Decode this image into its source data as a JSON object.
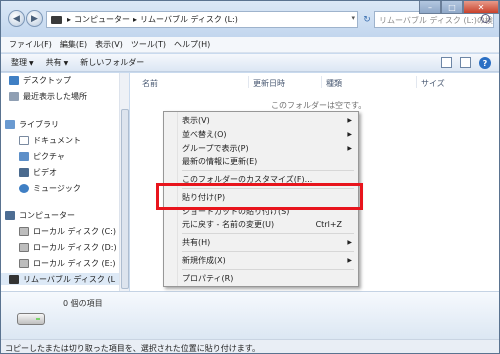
{
  "address": {
    "crumbs": [
      "コンピューター",
      "リムーバブル ディスク (L:)"
    ],
    "separator": "▸"
  },
  "search": {
    "placeholder": "リムーバブル ディスク (L:)の検索"
  },
  "window_controls": {
    "minimize": "–",
    "maximize": "□",
    "close": "✕"
  },
  "menubar": [
    "ファイル(F)",
    "編集(E)",
    "表示(V)",
    "ツール(T)",
    "ヘルプ(H)"
  ],
  "toolbar": {
    "organize": "整理",
    "share": "共有",
    "new_folder": "新しいフォルダー"
  },
  "navpane": {
    "favorites": [
      "デスクトップ",
      "最近表示した場所"
    ],
    "libraries_title": "ライブラリ",
    "libraries": [
      "ドキュメント",
      "ピクチャ",
      "ビデオ",
      "ミュージック"
    ],
    "computer_title": "コンピューター",
    "drives": [
      "ローカル ディスク (C:)",
      "ローカル ディスク (D:)",
      "ローカル ディスク (E:)",
      "リムーバブル ディスク (L"
    ]
  },
  "columns": {
    "name": "名前",
    "modified": "更新日時",
    "type": "種類",
    "size": "サイズ"
  },
  "empty_message": "このフォルダーは空です。",
  "context_menu": {
    "view": "表示(V)",
    "sort": "並べ替え(O)",
    "group": "グループで表示(P)",
    "refresh": "最新の情報に更新(E)",
    "customize": "このフォルダーのカスタマイズ(F)...",
    "paste": "貼り付け(P)",
    "paste_shortcut": "ショートカットの貼り付け(S)",
    "undo": "元に戻す - 名前の変更(U)",
    "undo_shortcut": "Ctrl+Z",
    "share": "共有(H)",
    "new": "新規作成(X)",
    "properties": "プロパティ(R)",
    "submenu_arrow": "▶"
  },
  "details": {
    "count": "0 個の項目"
  },
  "statusbar": {
    "text": "コピーしたまたは切り取った項目を、選択された位置に貼り付けます。"
  },
  "colors": {
    "highlight_box": "#e8141c",
    "window_frame": "#c9daee"
  }
}
